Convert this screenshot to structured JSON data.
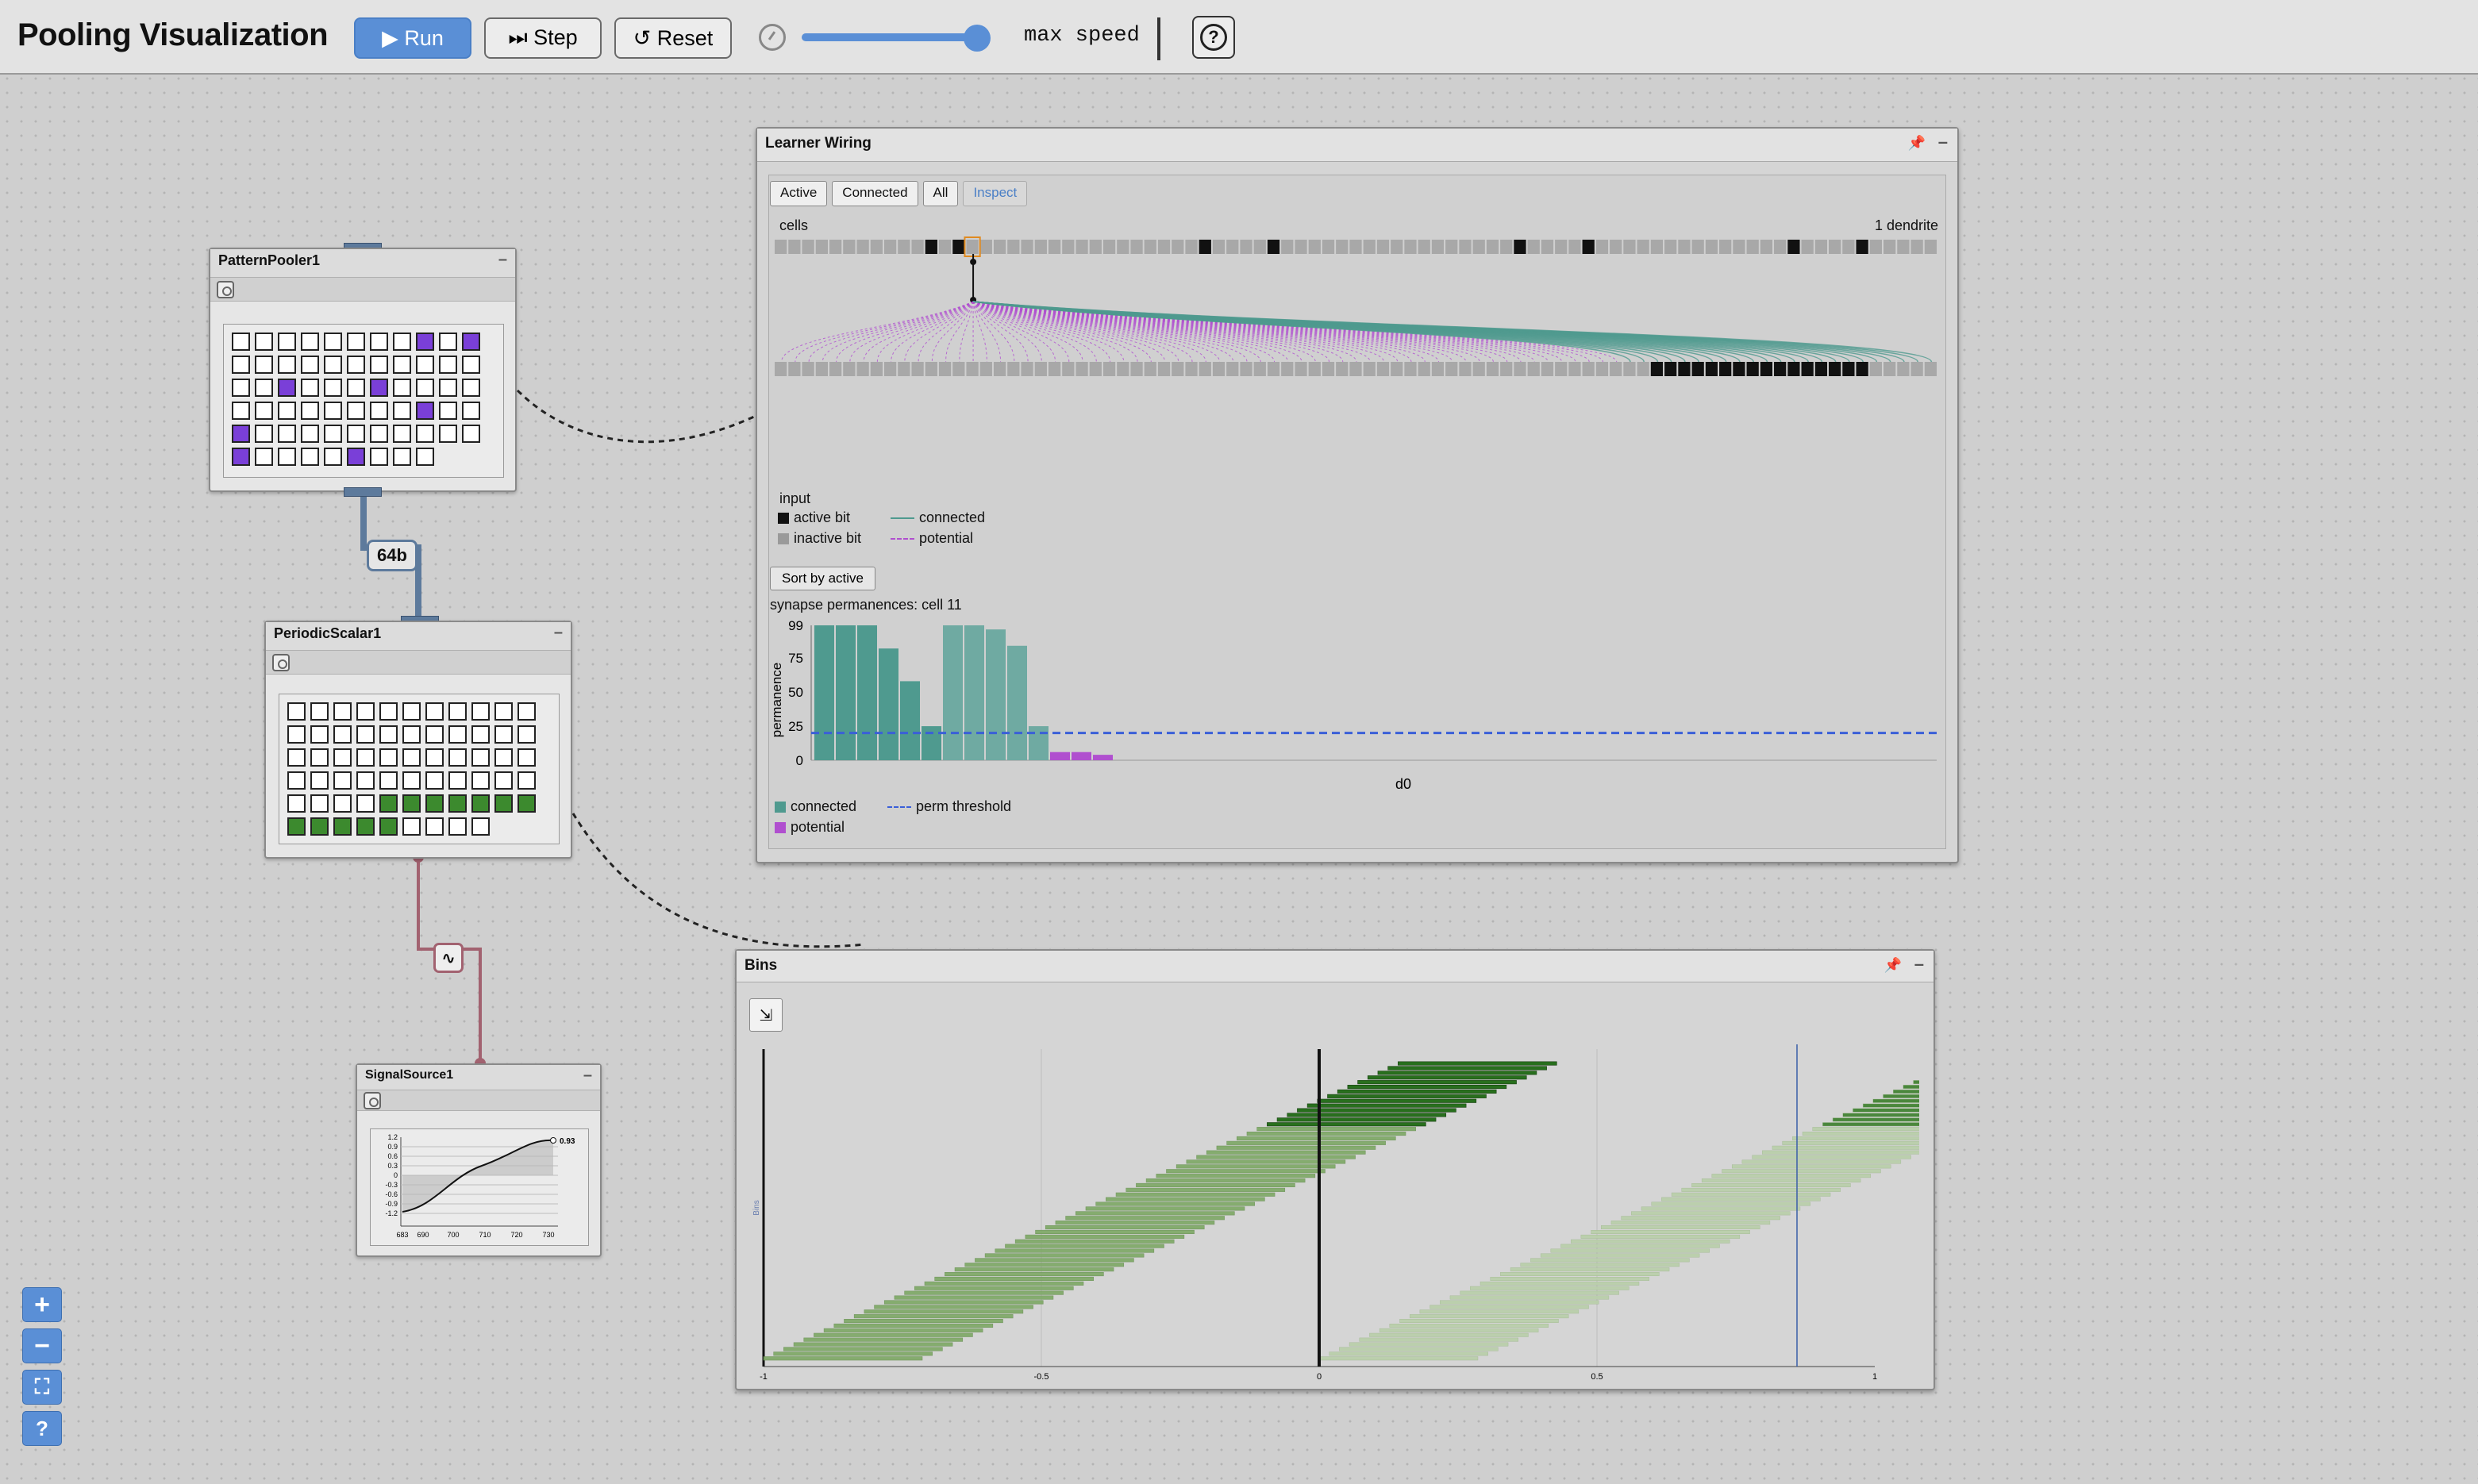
{
  "app": {
    "title": "Pooling Visualization"
  },
  "toolbar": {
    "run_label": "▶ Run",
    "step_label": "⏭ Step",
    "reset_label": "↺ Reset",
    "speed_label": "max speed",
    "speed_value": 1.0,
    "help_label": "?"
  },
  "nodes": {
    "pattern_pooler": {
      "title": "PatternPooler1",
      "min": "–"
    },
    "periodic_scalar": {
      "title": "PeriodicScalar1",
      "min": "–"
    },
    "signal_source": {
      "title": "SignalSource1",
      "min": "–",
      "value_label": "0.93",
      "yticks": [
        "1.2",
        "0.9",
        "0.6",
        "0.3",
        "0",
        "-0.3",
        "-0.6",
        "-0.9",
        "-1.2"
      ],
      "xticks": [
        "683",
        "690",
        "700",
        "710",
        "720",
        "730"
      ]
    },
    "link_label": "64b"
  },
  "learner": {
    "title": "Learner Wiring",
    "tabs": [
      "Active",
      "Connected",
      "All",
      "Inspect"
    ],
    "selected_tab": "Inspect",
    "cells_label": "cells",
    "dendrite_label": "1 dendrite",
    "input_label": "input",
    "legend": {
      "active_bit": "active bit",
      "inactive_bit": "inactive bit",
      "connected": "connected",
      "potential": "potential"
    },
    "sort_button": "Sort by active",
    "perm_title": "synapse permanences: cell 11",
    "y_axis_label": "permanence",
    "y_ticks": [
      "99",
      "75",
      "50",
      "25",
      "0"
    ],
    "x_label": "d0",
    "legend2": {
      "connected": "connected",
      "perm_threshold": "perm threshold",
      "potential": "potential"
    },
    "colors": {
      "connected": "#4f9a8f",
      "potential": "#b04fcf",
      "threshold": "#3a5fd8"
    }
  },
  "bins": {
    "title": "Bins",
    "y_label": "Bins",
    "x_ticks": [
      "-1",
      "-0.5",
      "0",
      "0.5",
      "1"
    ]
  },
  "zoom": {
    "in": "+",
    "out": "−",
    "fit": "⛶",
    "help": "?"
  }
}
